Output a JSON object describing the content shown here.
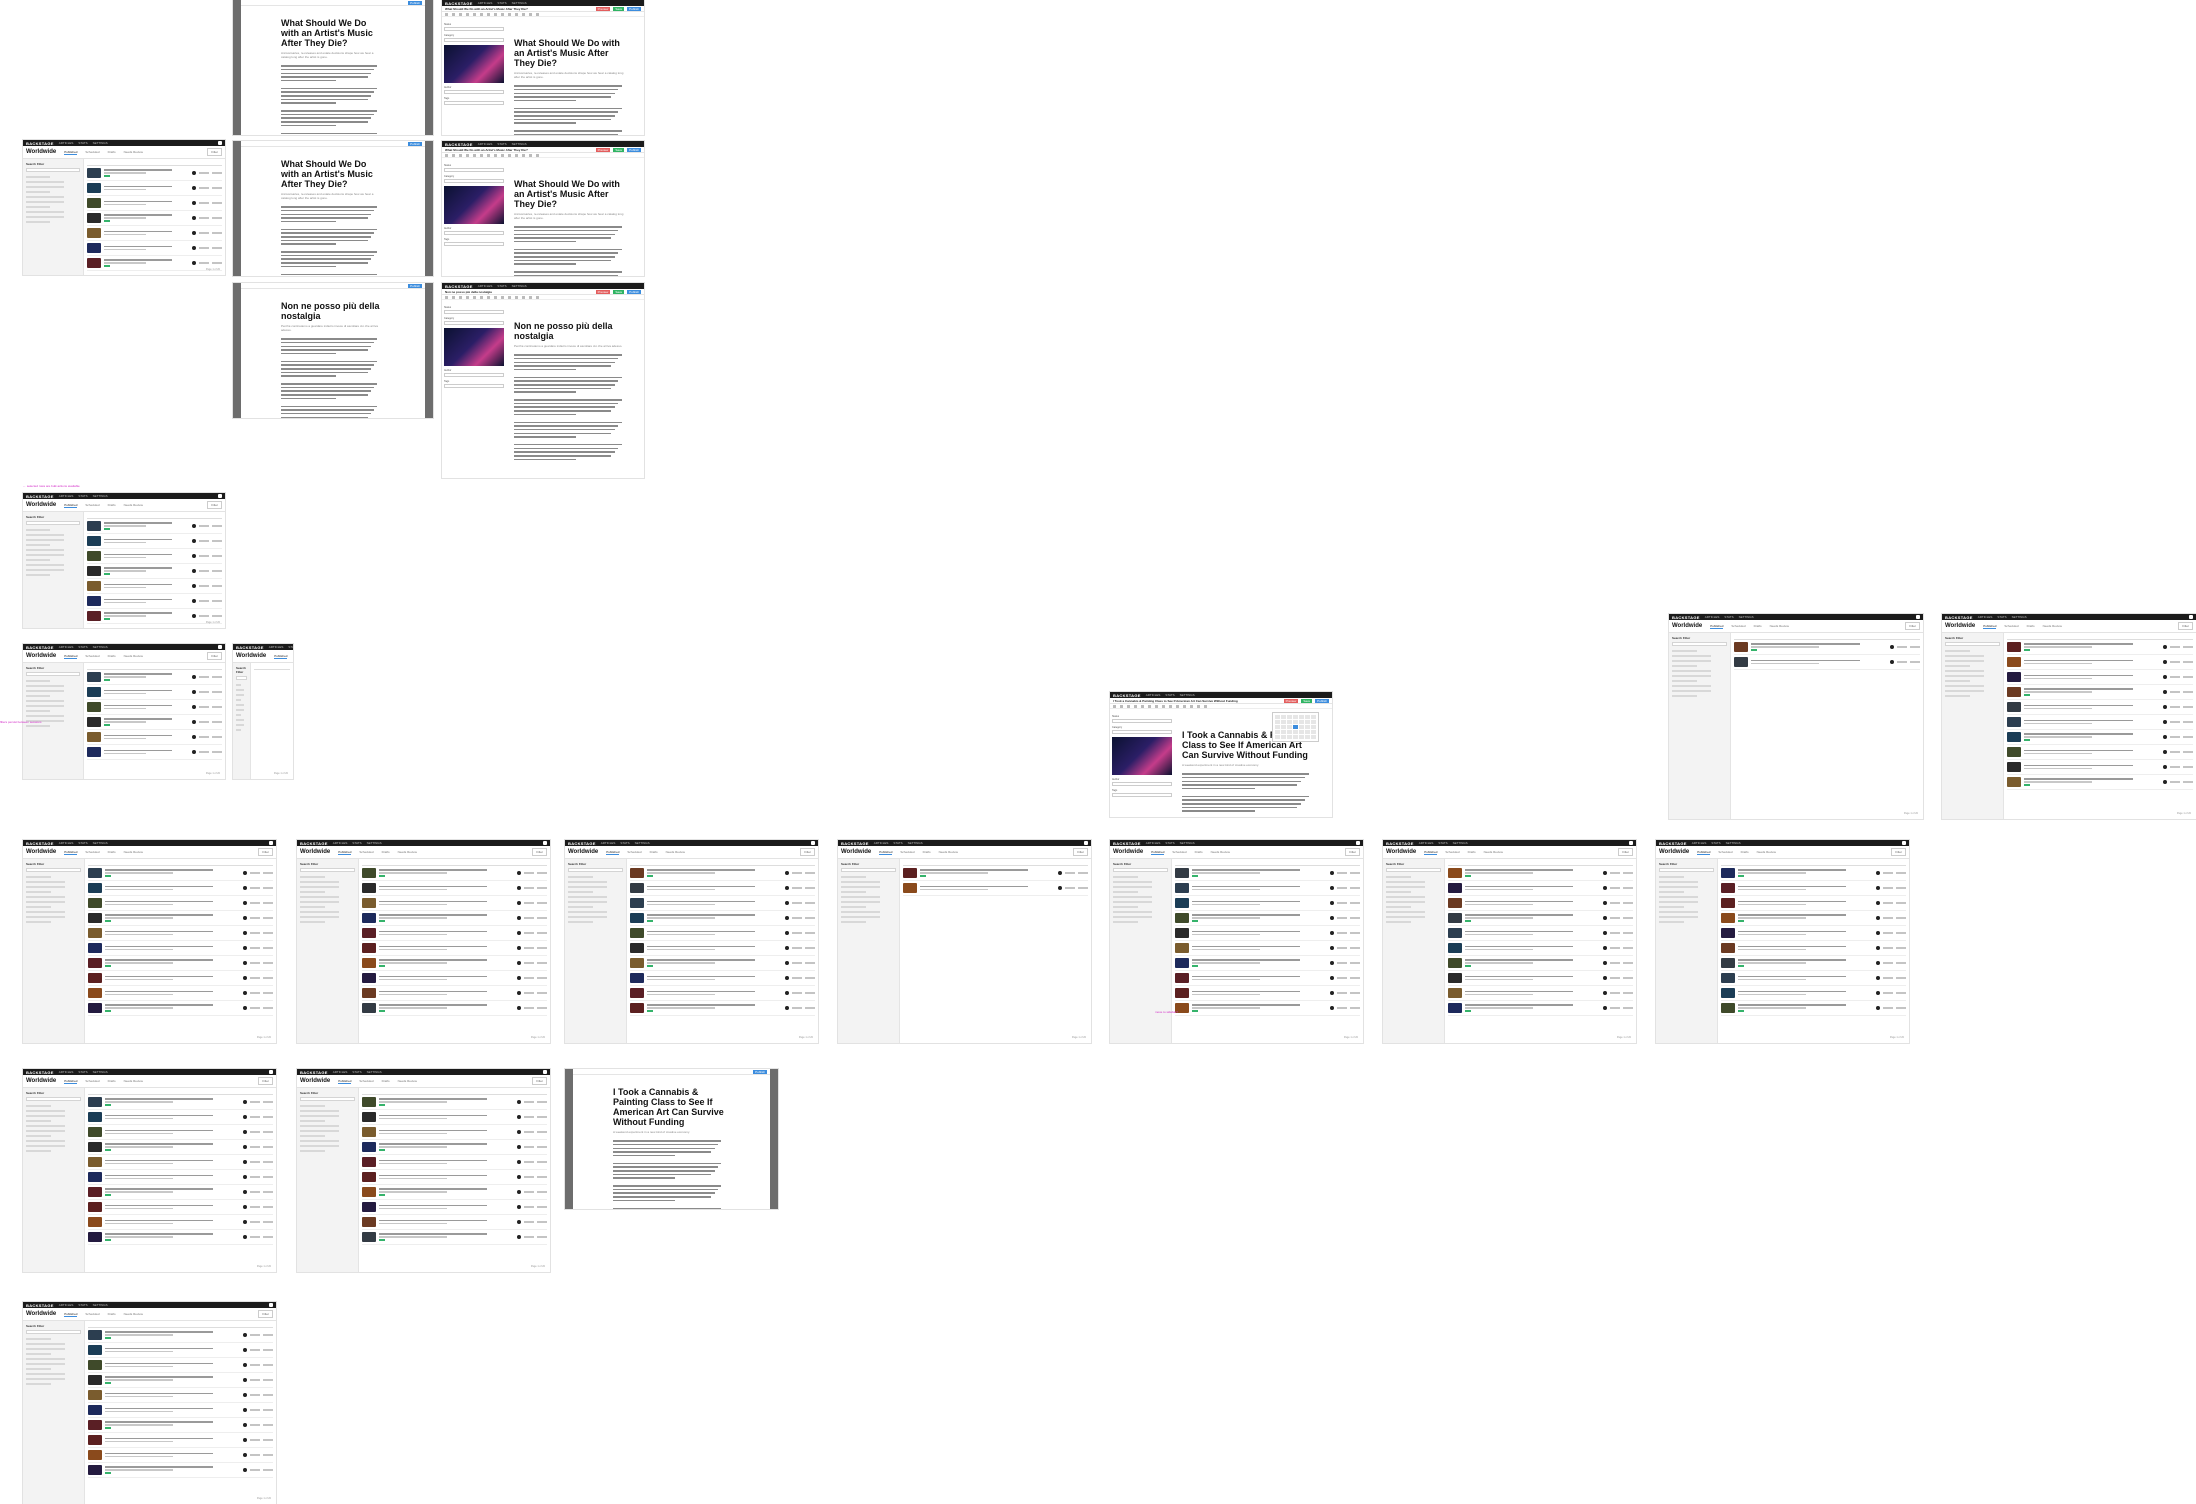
{
  "app": {
    "brand": "BACKSTAGE",
    "nav": [
      "ARTICLES",
      "STATS",
      "SETTINGS"
    ],
    "section_title": "Worldwide",
    "tabs": [
      "Published",
      "Scheduled",
      "Drafts",
      "Needs Review"
    ],
    "filter_label": "Filter",
    "sidebar_title": "Search Filter",
    "pagination": "Page 1 of 20"
  },
  "editor": {
    "save": "Save",
    "preview": "Preview",
    "publish": "Publish",
    "sidebar_labels": [
      "Status",
      "Category",
      "Author",
      "Tags"
    ]
  },
  "articles": {
    "a1": {
      "title": "What Should We Do with an Artist's Music After They Die?",
      "subtitle": "Anniversaries, re-releases and estate decisions shape how we hear a catalog long after the artist is gone."
    },
    "a2": {
      "title": "Non ne posso più della nostalgia",
      "subtitle": "Perché continuiamo a guardare indietro invece di ascoltare ciò che arriva adesso."
    },
    "a3": {
      "title": "I Took a Cannabis & Painting Class to See If American Art Can Survive Without Funding",
      "subtitle": "A weekend experiment in a new kind of creative economy."
    }
  },
  "notes": [
    "← selected rows are bulk actions available",
    "filters persist between sessions",
    "move to sidebar?"
  ],
  "colors": {
    "accent": "#3c8dde",
    "success": "#2fb463",
    "danger": "#e35d5d",
    "annotation": "#d22ac7"
  }
}
